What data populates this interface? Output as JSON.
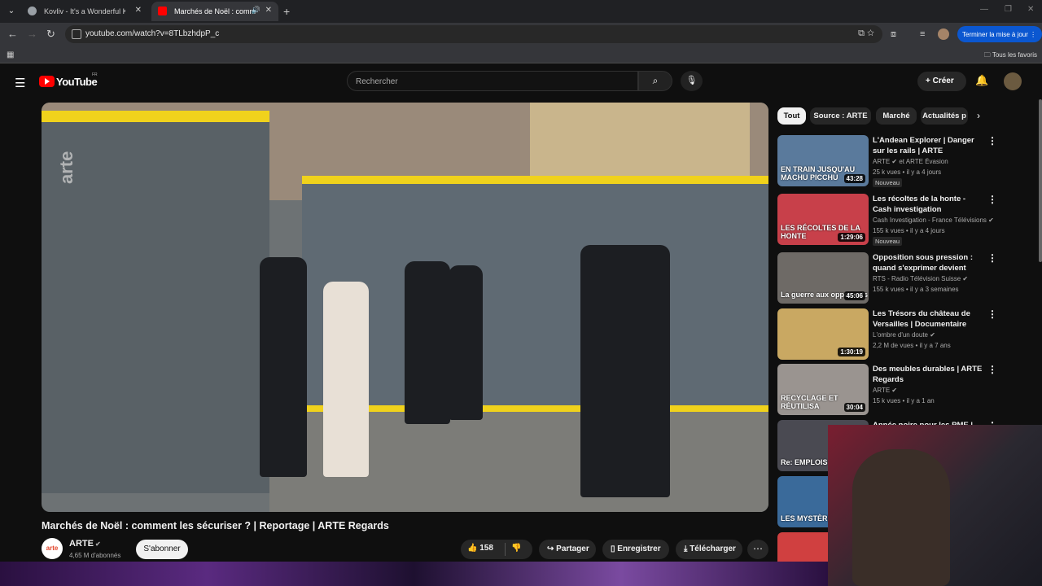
{
  "browser": {
    "tabs": [
      {
        "title": "Kovliv - It's a Wonderful Knife (",
        "active": false
      },
      {
        "title": "Marchés de Noël : commen",
        "active": true
      }
    ],
    "url": "youtube.com/watch?v=8TLbzhdpP_c",
    "update_button": "Terminer la mise à jour",
    "bookmarks_all": "Tous les favoris"
  },
  "header": {
    "logo": "YouTube",
    "region": "FR",
    "search_placeholder": "Rechercher",
    "create_label": "Créer"
  },
  "video": {
    "title": "Marchés de Noël : comment les sécuriser ? | Reportage | ARTE Regards",
    "watermark": "arte",
    "channel": {
      "avatar_text": "arte",
      "name": "ARTE",
      "subscribers": "4,65 M d'abonnés"
    },
    "subscribe_label": "S'abonner",
    "likes": "158",
    "actions": {
      "share": "Partager",
      "save": "Enregistrer",
      "download": "Télécharger"
    }
  },
  "chips": [
    "Tout",
    "Source : ARTE",
    "Marché",
    "Actualités p"
  ],
  "recommendations": [
    {
      "title": "L'Andean Explorer | Danger sur les rails | ARTE",
      "channel": "ARTE ✔ et ARTE Évasion",
      "meta": "25 k vues • il y a 4 jours",
      "duration": "43:28",
      "badge": "Nouveau",
      "overlay": "EN TRAIN JUSQU'AU MACHU PICCHU",
      "thumb_color": "#5a7a9c"
    },
    {
      "title": "Les récoltes de la honte - Cash investigation",
      "channel": "Cash Investigation - France Télévisions ✔",
      "meta": "155 k vues • il y a 4 jours",
      "duration": "1:29:06",
      "badge": "Nouveau",
      "overlay": "LES RÉCOLTES DE LA HONTE",
      "thumb_color": "#c8404a"
    },
    {
      "title": "Opposition sous pression : quand s'exprimer devient risqu...",
      "channel": "RTS - Radio Télévision Suisse ✔",
      "meta": "155 k vues • il y a 3 semaines",
      "duration": "45:06",
      "badge": "",
      "overlay": "La guerre aux opposants",
      "thumb_color": "#6e6a66"
    },
    {
      "title": "Les Trésors du château de Versailles | Documentaire",
      "channel": "L'ombre d'un doute ✔",
      "meta": "2,2 M de vues • il y a 7 ans",
      "duration": "1:30:19",
      "badge": "",
      "overlay": "",
      "thumb_color": "#c9a862"
    },
    {
      "title": "Des meubles durables | ARTE Regards",
      "channel": "ARTE ✔",
      "meta": "15 k vues • il y a 1 an",
      "duration": "30:04",
      "badge": "",
      "overlay": "RECYCLAGE ET RÉUTILISA",
      "thumb_color": "#9a9490"
    },
    {
      "title": "Année noire pour les PME |",
      "channel": "",
      "meta": "",
      "duration": "",
      "badge": "",
      "overlay": "Re: EMPLOIS ME",
      "thumb_color": "#4a4a52"
    },
    {
      "title": "",
      "channel": "",
      "meta": "",
      "duration": "",
      "badge": "",
      "overlay": "LES MYSTÈRES DE",
      "thumb_color": "#3a6a9a"
    },
    {
      "title": "",
      "channel": "",
      "meta": "",
      "duration": "",
      "badge": "",
      "overlay": "",
      "thumb_color": "#d04040"
    }
  ],
  "colors": {
    "accent_red": "#ff0000",
    "arte_yellow": "#f0d21c",
    "update_blue": "#0b57d0"
  }
}
